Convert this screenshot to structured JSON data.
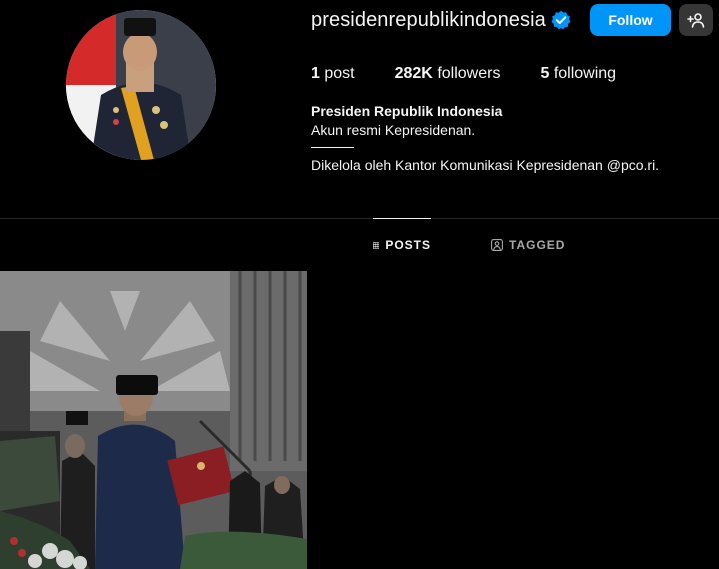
{
  "profile": {
    "username": "presidenrepublikindonesia",
    "follow_label": "Follow",
    "name": "Presiden Republik Indonesia",
    "bio": "Akun resmi Kepresidenan.",
    "managed_by": "Dikelola oleh Kantor Komunikasi Kepresidenan @pco.ri."
  },
  "stats": {
    "posts_count": "1",
    "posts_label": "post",
    "followers_count": "282K",
    "followers_label": "followers",
    "following_count": "5",
    "following_label": "following"
  },
  "tabs": [
    {
      "label": "POSTS",
      "icon": "grid-icon",
      "active": true
    },
    {
      "label": "TAGGED",
      "icon": "tagged-icon",
      "active": false
    }
  ],
  "colors": {
    "background": "#000000",
    "follow_button": "#0095f6",
    "verified_badge": "#0095f6",
    "secondary_button": "#363636"
  }
}
